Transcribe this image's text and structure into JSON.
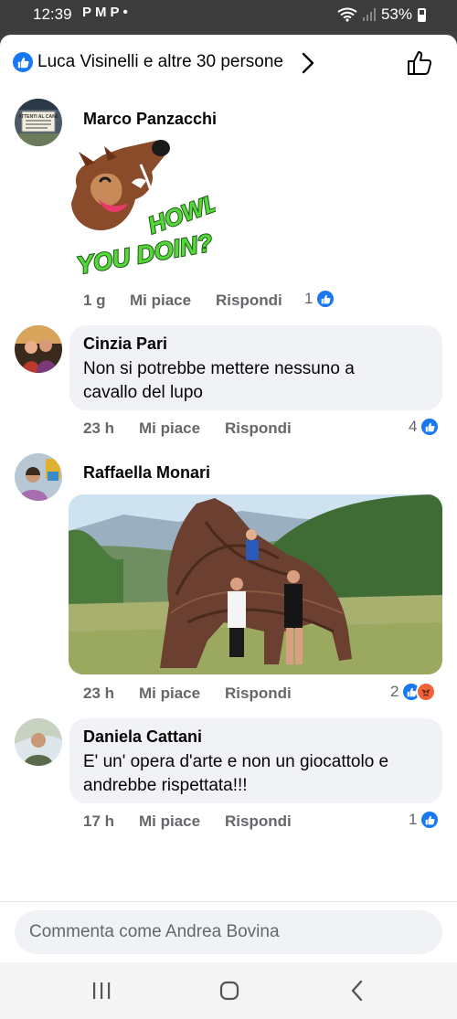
{
  "status_bar": {
    "time": "12:39",
    "notification_icons": [
      "P",
      "M",
      "P",
      "•"
    ],
    "battery": "53%"
  },
  "header": {
    "reactors_text": "Luca Visinelli e altre 30 persone"
  },
  "comments": [
    {
      "author": "Marco Panzacchi",
      "attachment": "sticker",
      "sticker_text": [
        "HOWL",
        "YOU DOIN?"
      ],
      "avatar_sign_text": [
        "ATTENTI AL CANE"
      ],
      "time": "1 g",
      "like_label": "Mi piace",
      "reply_label": "Rispondi",
      "reaction_count": "1",
      "reactions": [
        "like"
      ]
    },
    {
      "author": "Cinzia Pari",
      "text": "Non si potrebbe mettere nessuno a cavallo del lupo",
      "text_lines": [
        "Non si potrebbe mettere nessuno a",
        "cavallo del lupo"
      ],
      "time": "23 h",
      "like_label": "Mi piace",
      "reply_label": "Rispondi",
      "reaction_count": "4",
      "reactions": [
        "like"
      ]
    },
    {
      "author": "Raffaella Monari",
      "attachment": "photo",
      "time": "23 h",
      "like_label": "Mi piace",
      "reply_label": "Rispondi",
      "reaction_count": "2",
      "reactions": [
        "like",
        "angry"
      ]
    },
    {
      "author": "Daniela Cattani",
      "text": "E' un' opera d'arte e non un giocattolo e andrebbe rispettata!!!",
      "text_lines": [
        "E' un' opera d'arte e non un giocattolo e",
        "andrebbe rispettata!!!"
      ],
      "time": "17 h",
      "like_label": "Mi piace",
      "reply_label": "Rispondi",
      "reaction_count": "1",
      "reactions": [
        "like"
      ]
    }
  ],
  "composer": {
    "placeholder": "Commenta come Andrea Bovina"
  },
  "nav": {
    "icons": [
      "recent-apps-icon",
      "home-icon",
      "back-icon"
    ]
  },
  "colors": {
    "facebook_blue": "#1877f2",
    "bubble": "#f0f2f5",
    "meta_gray": "#65676b",
    "angry": "#f0623a"
  }
}
